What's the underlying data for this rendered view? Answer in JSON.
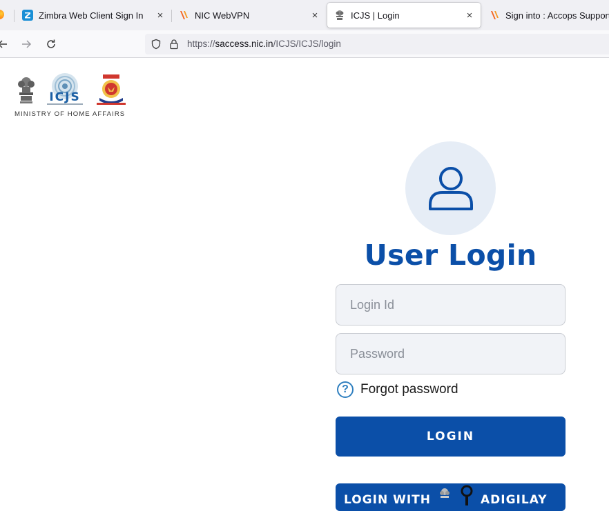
{
  "browser": {
    "tabs": [
      {
        "title": "Zimbra Web Client Sign In",
        "favicon": "zimbra-icon",
        "close": "×"
      },
      {
        "title": "NIC WebVPN",
        "favicon": "vpn-icon",
        "close": "×"
      },
      {
        "title": "ICJS | Login",
        "favicon": "emblem-icon",
        "close": "×",
        "active": true
      },
      {
        "title": "Sign into : Accops Support Po",
        "favicon": "vpn-icon"
      }
    ],
    "url": {
      "prefix": "https://",
      "host": "saccess.nic.in",
      "path": "/ICJS/ICJS/login"
    }
  },
  "header": {
    "logo_text": "ICJS",
    "ministry": "MINISTRY OF HOME AFFAIRS"
  },
  "login": {
    "heading": "User Login",
    "avatar_icon": "user-icon",
    "login_id_placeholder": "Login Id",
    "password_placeholder": "Password",
    "forgot_icon": "?",
    "forgot_label": "Forgot password",
    "login_button": "LOGIN",
    "login_with_prefix": "LOGIN WITH",
    "login_with_suffix": "ADIGILAY"
  },
  "colors": {
    "accent": "#0b4fa8",
    "avatar_bg": "#e6edf6",
    "field_bg": "#f1f3f7"
  }
}
